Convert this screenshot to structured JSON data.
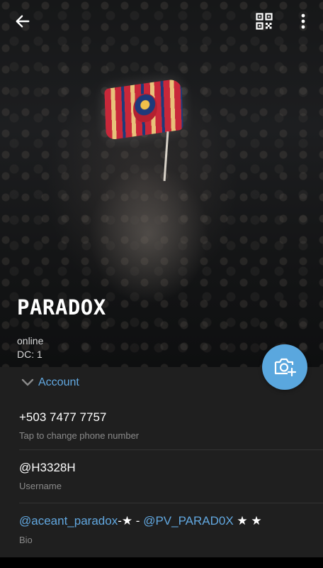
{
  "header": {
    "back_icon": "arrow-left-icon",
    "qr_icon": "qr-code-icon",
    "more_icon": "more-vertical-icon",
    "name": "PARADOX",
    "status": "online",
    "dc": "DC: 1"
  },
  "fab": {
    "icon": "camera-add-icon",
    "color": "#5aa7de"
  },
  "account": {
    "section_label": "Account",
    "chevron_icon": "chevron-down-icon",
    "phone": {
      "value": "+503 7477 7757",
      "caption": "Tap to change phone number"
    },
    "username": {
      "value": "@H3328H",
      "caption": "Username"
    },
    "bio": {
      "link1": "@aceant_paradox",
      "sep1": "-★ - ",
      "link2": "@PV_PARAD0X",
      "sep2": " ★ ★",
      "caption": "Bio"
    }
  },
  "colors": {
    "accent": "#62a8e0",
    "background": "#1f1f1f"
  }
}
